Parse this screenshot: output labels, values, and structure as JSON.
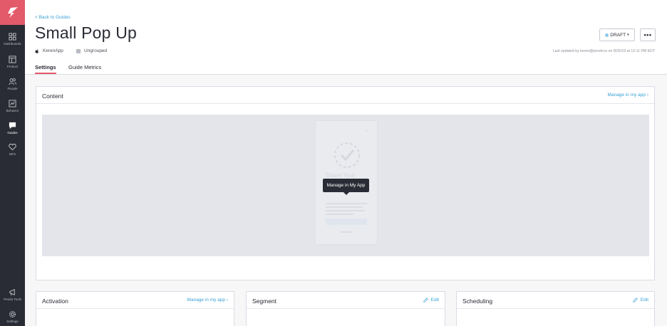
{
  "sidebar": {
    "items": [
      {
        "label": "Dashboards",
        "icon": "dashboard-icon"
      },
      {
        "label": "Product",
        "icon": "product-icon"
      },
      {
        "label": "People",
        "icon": "people-icon"
      },
      {
        "label": "Behavior",
        "icon": "behavior-icon"
      },
      {
        "label": "Guides",
        "icon": "guides-icon",
        "active": true
      },
      {
        "label": "NPS",
        "icon": "nps-icon"
      }
    ],
    "bottom_items": [
      {
        "label": "Pendo Tools",
        "icon": "megaphone-icon"
      },
      {
        "label": "Settings",
        "icon": "gear-icon"
      }
    ]
  },
  "header": {
    "back_link": "< Back to Guides",
    "title": "Small Pop Up",
    "app_name": "KerenApp",
    "group": "Ungrouped",
    "last_updated": "Last updated by keren@pendo.io on 8/25/19 at 12:11 PM EDT",
    "status_button": "DRAFT",
    "more_button": "•••",
    "tabs": [
      {
        "label": "Settings",
        "active": true
      },
      {
        "label": "Guide Metrics"
      }
    ]
  },
  "content_panel": {
    "title": "Content",
    "link": "Manage in my app ›",
    "preview_ghost_title": "Share Your",
    "tooltip": "Manage in My App"
  },
  "bottom_panels": [
    {
      "title": "Activation",
      "link": "Manage in my app ›"
    },
    {
      "title": "Segment",
      "link": "Edit"
    },
    {
      "title": "Scheduling",
      "link": "Edit"
    }
  ],
  "colors": {
    "accent": "#e35a6b",
    "sidebar": "#2a2c35",
    "link": "#3aa0d5"
  }
}
